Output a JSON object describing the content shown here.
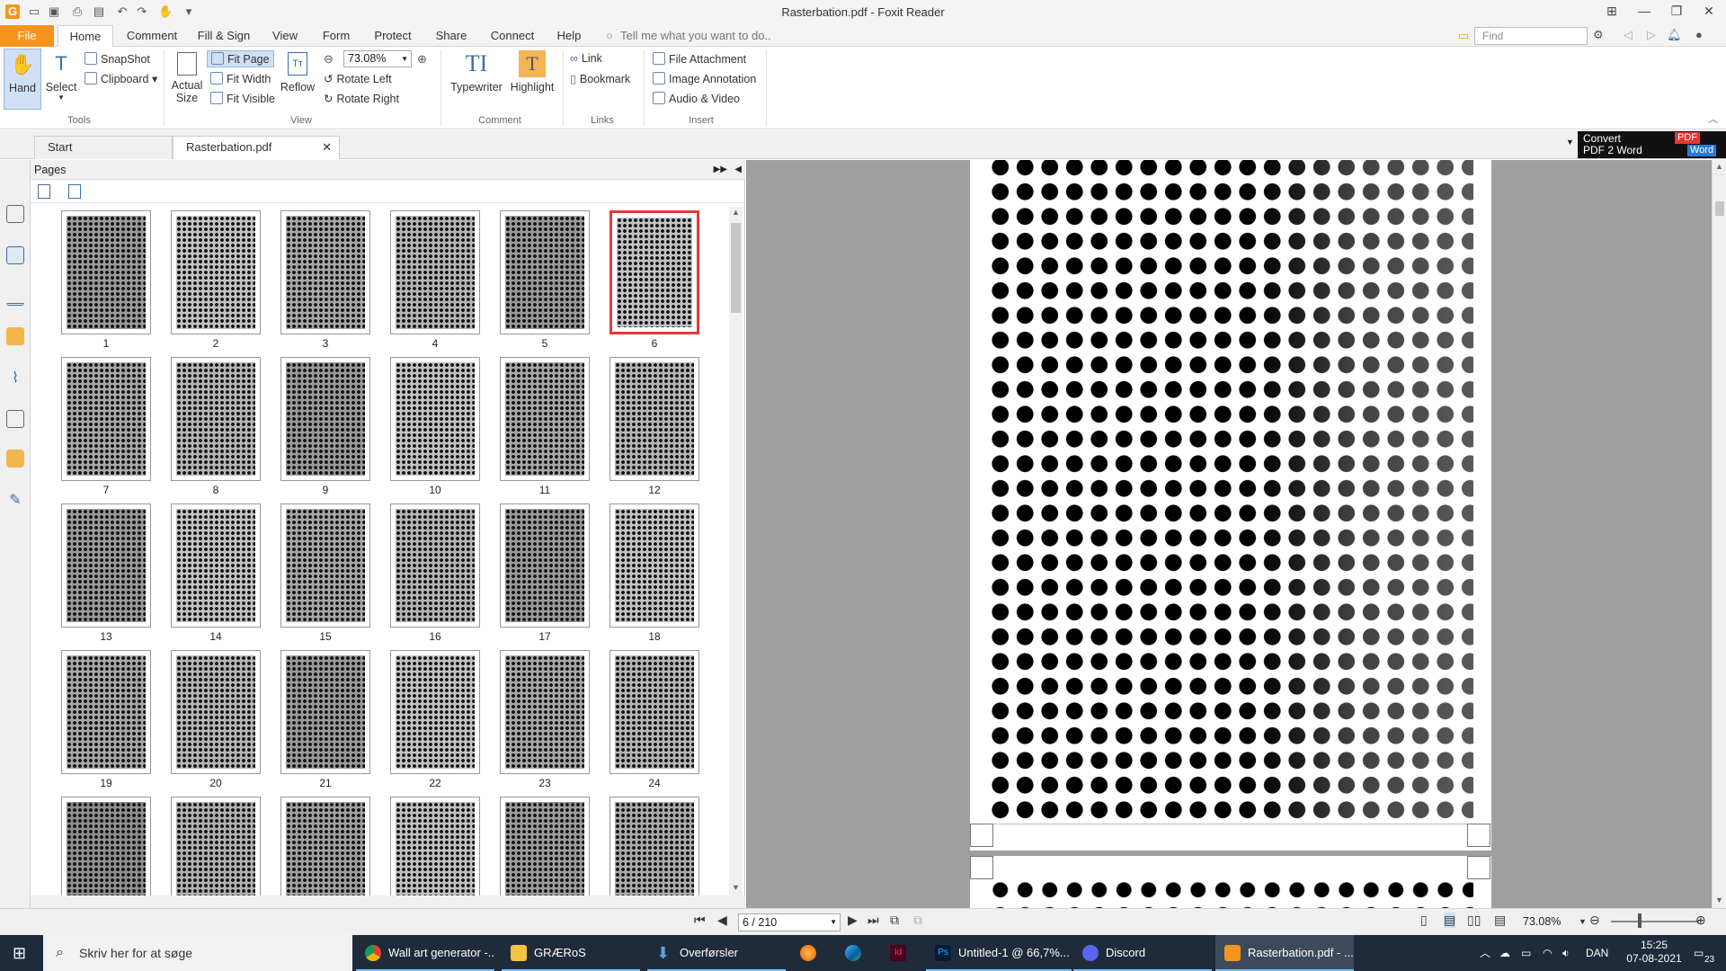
{
  "window": {
    "title": "Rasterbation.pdf - Foxit Reader"
  },
  "menu": {
    "file": "File",
    "home": "Home",
    "comment": "Comment",
    "fill_sign": "Fill & Sign",
    "view": "View",
    "form": "Form",
    "protect": "Protect",
    "share": "Share",
    "connect": "Connect",
    "help": "Help",
    "tell_me": "Tell me what you want to do..",
    "find_placeholder": "Find"
  },
  "ribbon": {
    "tools": {
      "hand": "Hand",
      "select": "Select",
      "snapshot": "SnapShot",
      "clipboard": "Clipboard",
      "group": "Tools"
    },
    "view": {
      "actual_size_1": "Actual",
      "actual_size_2": "Size",
      "fit_page": "Fit Page",
      "fit_width": "Fit Width",
      "fit_visible": "Fit Visible",
      "reflow": "Reflow",
      "zoom": "73.08%",
      "rotate_left": "Rotate Left",
      "rotate_right": "Rotate Right",
      "group": "View"
    },
    "comment": {
      "typewriter": "Typewriter",
      "highlight": "Highlight",
      "group": "Comment"
    },
    "links": {
      "link": "Link",
      "bookmark": "Bookmark",
      "group": "Links"
    },
    "insert": {
      "file_attachment": "File Attachment",
      "image_annotation": "Image Annotation",
      "audio_video": "Audio & Video",
      "group": "Insert"
    }
  },
  "tabs": {
    "start": "Start",
    "doc": "Rasterbation.pdf"
  },
  "convert": {
    "line1": "Convert",
    "line2": "PDF 2 Word",
    "pdf": "PDF",
    "word": "Word"
  },
  "pages_panel": {
    "title": "Pages",
    "selected_page": 6,
    "thumbnails": [
      "1",
      "2",
      "3",
      "4",
      "5",
      "6",
      "7",
      "8",
      "9",
      "10",
      "11",
      "12",
      "13",
      "14",
      "15",
      "16",
      "17",
      "18",
      "19",
      "20",
      "21",
      "22",
      "23",
      "24"
    ]
  },
  "statusbar": {
    "page_indicator": "6 / 210",
    "zoom": "73.08%"
  },
  "taskbar": {
    "search_placeholder": "Skriv her for at søge",
    "items": [
      {
        "label": "Wall art generator -..."
      },
      {
        "label": "GRÆRoS"
      },
      {
        "label": "Overførsler"
      },
      {
        "label": "Untitled-1 @ 66,7%..."
      },
      {
        "label": "Discord"
      },
      {
        "label": "Rasterbation.pdf - ..."
      }
    ],
    "lang": "DAN",
    "time": "15:25",
    "date": "07-08-2021",
    "notif_count": "23"
  }
}
